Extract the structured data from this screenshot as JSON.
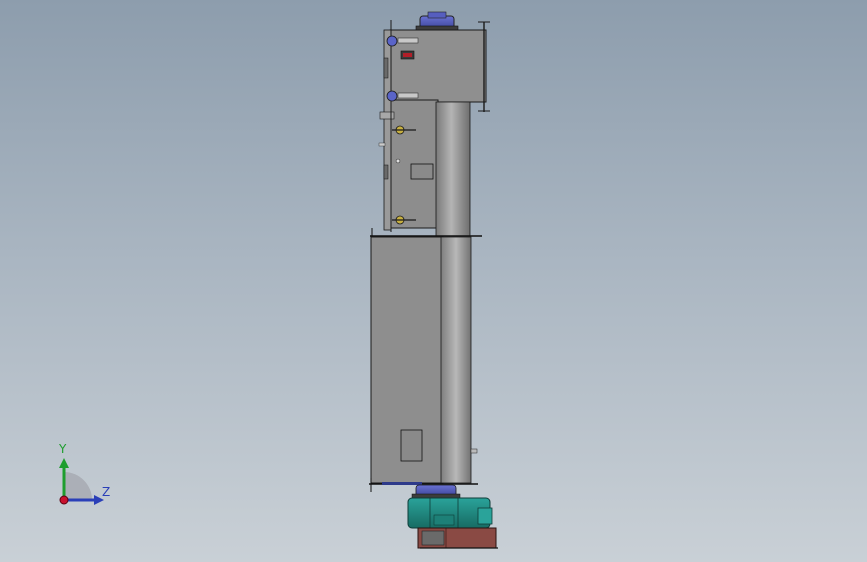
{
  "viewport": {
    "background_top": "#8d9dad",
    "background_bottom": "#c9d0d6"
  },
  "triad": {
    "y_label": "Y",
    "z_label": "Z",
    "y_color": "#1e9e2e",
    "z_color": "#2a3fb8",
    "x_color": "#c8102e"
  },
  "model": {
    "body_color": "#8a8a8a",
    "fan_color": "#1f8a80",
    "motor_color": "#4a54b8",
    "base_color": "#8a4a44",
    "indicator_color": "#b11e28"
  }
}
